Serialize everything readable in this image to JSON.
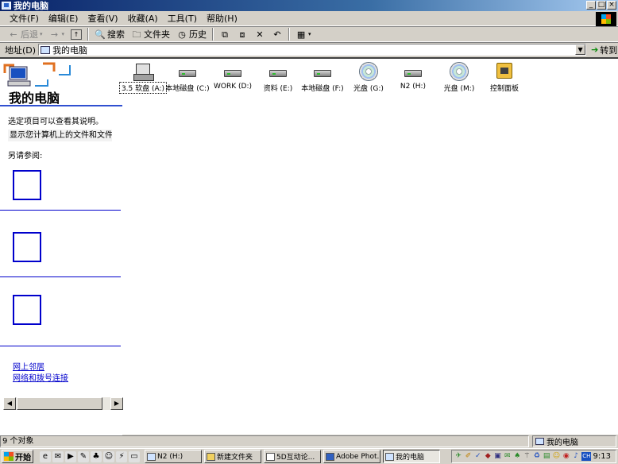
{
  "window": {
    "title": "我的电脑",
    "controls": [
      "_",
      "□",
      "×"
    ]
  },
  "menu": [
    "文件(F)",
    "编辑(E)",
    "查看(V)",
    "收藏(A)",
    "工具(T)",
    "帮助(H)"
  ],
  "toolbar": {
    "back": "后退",
    "search": "搜索",
    "folders": "文件夹",
    "history": "历史"
  },
  "address": {
    "label": "地址(D)",
    "value": "我的电脑",
    "go": "转到"
  },
  "left_panel": {
    "title": "我的电脑",
    "description": "选定项目可以查看其说明。",
    "tip": "显示您计算机上的文件和文件夹",
    "see_also": "另请参阅:",
    "links": [
      "网上邻居",
      "网络和拨号连接"
    ]
  },
  "drives": [
    {
      "label": "3.5 软盘 (A:)",
      "icon": "floppy-icon",
      "selected": true
    },
    {
      "label": "本地磁盘 (C:)",
      "icon": "hard-drive-icon"
    },
    {
      "label": "WORK (D:)",
      "icon": "hard-drive-icon"
    },
    {
      "label": "资料 (E:)",
      "icon": "hard-drive-icon"
    },
    {
      "label": "本地磁盘 (F:)",
      "icon": "hard-drive-icon"
    },
    {
      "label": "光盘 (G:)",
      "icon": "cd-drive-icon"
    },
    {
      "label": "N2 (H:)",
      "icon": "hard-drive-icon"
    },
    {
      "label": "光盘 (M:)",
      "icon": "cd-drive-icon"
    },
    {
      "label": "控制面板",
      "icon": "control-panel-icon"
    }
  ],
  "status": {
    "left": "9 个对象",
    "right": "我的电脑"
  },
  "taskbar": {
    "start": "开始",
    "tasks": [
      "N2 (H:)",
      "新建文件夹",
      "5D互动论...",
      "Adobe Phot...",
      "我的电脑"
    ],
    "active_task": 4,
    "tray_badge": "CH",
    "clock": "9:13"
  }
}
